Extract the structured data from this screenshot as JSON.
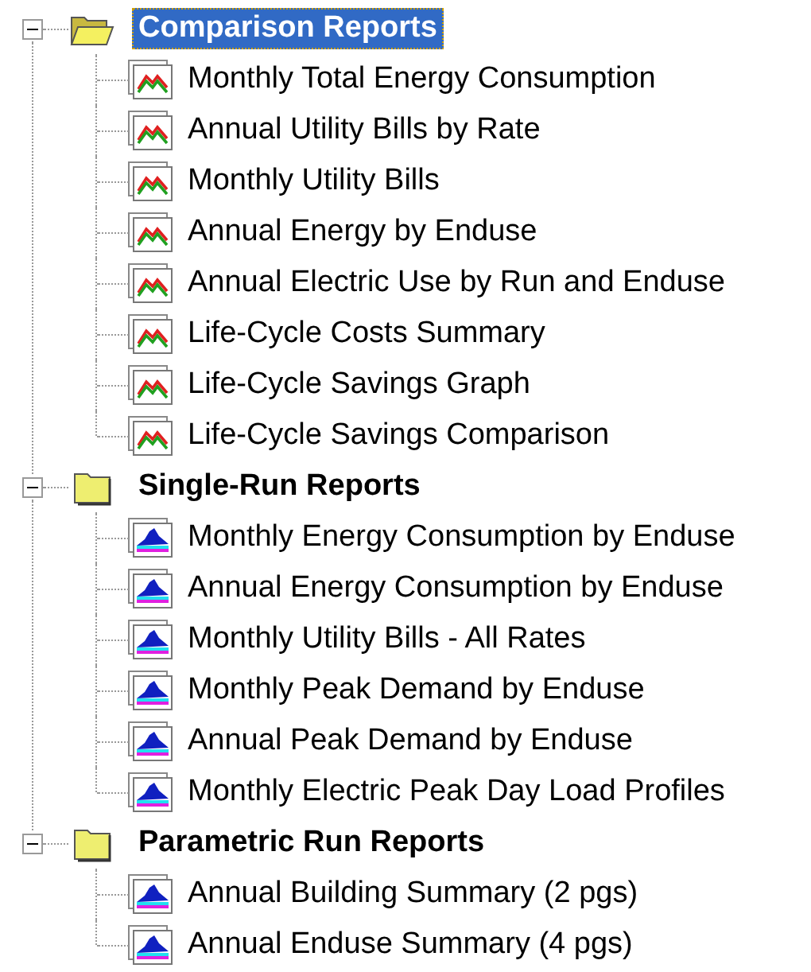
{
  "tree": [
    {
      "label": "Comparison Reports",
      "expanded": true,
      "selected": true,
      "children": [
        {
          "label": "Monthly Total Energy Consumption",
          "kind": "line"
        },
        {
          "label": "Annual Utility Bills by Rate",
          "kind": "line"
        },
        {
          "label": "Monthly Utility Bills",
          "kind": "line"
        },
        {
          "label": "Annual Energy by Enduse",
          "kind": "line"
        },
        {
          "label": "Annual Electric Use by Run and Enduse",
          "kind": "line"
        },
        {
          "label": "Life-Cycle Costs Summary",
          "kind": "line"
        },
        {
          "label": "Life-Cycle Savings Graph",
          "kind": "line"
        },
        {
          "label": "Life-Cycle Savings Comparison",
          "kind": "line"
        }
      ]
    },
    {
      "label": "Single-Run Reports",
      "expanded": true,
      "selected": false,
      "children": [
        {
          "label": "Monthly Energy Consumption by Enduse",
          "kind": "area"
        },
        {
          "label": "Annual Energy Consumption by Enduse",
          "kind": "area"
        },
        {
          "label": "Monthly Utility Bills - All Rates",
          "kind": "area"
        },
        {
          "label": "Monthly Peak Demand by Enduse",
          "kind": "area"
        },
        {
          "label": "Annual Peak Demand by Enduse",
          "kind": "area"
        },
        {
          "label": "Monthly Electric Peak Day Load Profiles",
          "kind": "area"
        }
      ]
    },
    {
      "label": "Parametric Run Reports",
      "expanded": true,
      "selected": false,
      "children": [
        {
          "label": "Annual Building Summary (2 pgs)",
          "kind": "area"
        },
        {
          "label": "Annual Enduse Summary (4 pgs)",
          "kind": "area"
        }
      ]
    }
  ]
}
